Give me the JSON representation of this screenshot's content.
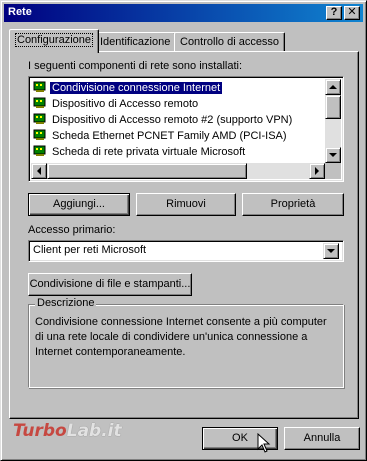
{
  "window": {
    "title": "Rete",
    "help_button": "?",
    "close_button": "✕"
  },
  "tabs": [
    {
      "label": "Configurazione",
      "active": true
    },
    {
      "label": "Identificazione",
      "active": false
    },
    {
      "label": "Controllo di accesso",
      "active": false
    }
  ],
  "components": {
    "label": "I seguenti componenti di rete sono installati:",
    "items": [
      {
        "label": "Condivisione connessione Internet",
        "selected": true,
        "icon": "network-adapter-icon"
      },
      {
        "label": "Dispositivo di Accesso remoto",
        "selected": false,
        "icon": "network-adapter-icon"
      },
      {
        "label": "Dispositivo di Accesso remoto #2 (supporto VPN)",
        "selected": false,
        "icon": "network-adapter-icon"
      },
      {
        "label": "Scheda  Ethernet PCNET Family AMD (PCI-ISA)",
        "selected": false,
        "icon": "network-adapter-icon"
      },
      {
        "label": "Scheda di rete privata virtuale Microsoft",
        "selected": false,
        "icon": "network-adapter-icon"
      }
    ]
  },
  "buttons": {
    "add": "Aggiungi...",
    "remove": "Rimuovi",
    "properties": "Proprietà"
  },
  "primary_logon": {
    "label": "Accesso primario:",
    "value": "Client per reti Microsoft"
  },
  "sharing_button": "Condivisione di file e stampanti...",
  "description": {
    "legend": "Descrizione",
    "text": "Condivisione connessione Internet consente a più computer di una rete locale di condividere un'unica connessione a Internet contemporaneamente."
  },
  "footer": {
    "ok": "OK",
    "cancel": "Annulla"
  },
  "watermark": {
    "part1": "Turbo",
    "part2": "Lab.it"
  },
  "colors": {
    "titlebar_start": "#000080",
    "titlebar_end": "#1084d0",
    "selection": "#000080",
    "face": "#c0c0c0"
  }
}
